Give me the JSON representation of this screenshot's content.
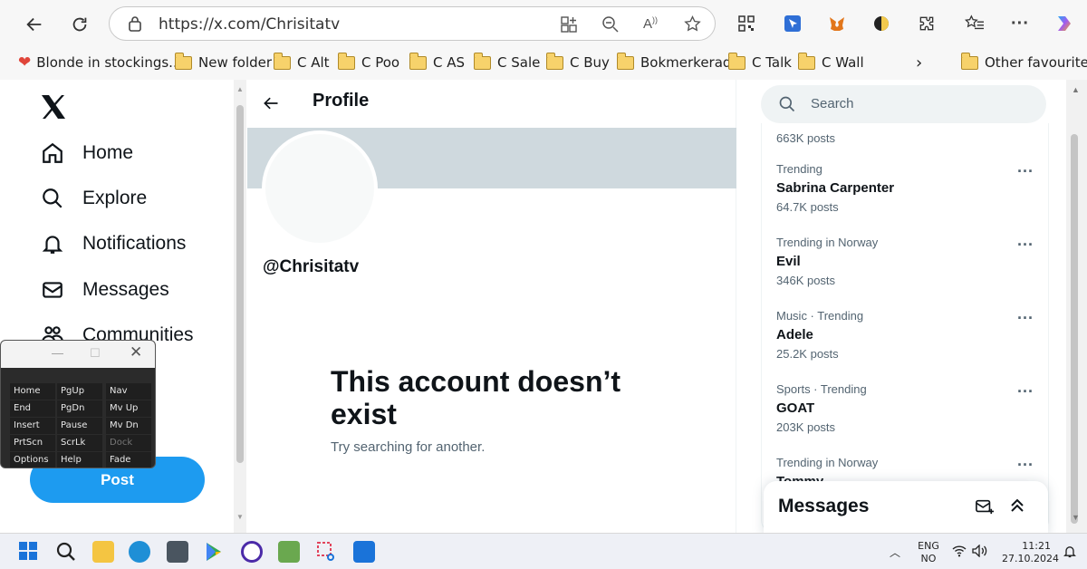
{
  "browser": {
    "url": "https://x.com/Chrisitatv",
    "bookmarks": [
      {
        "label": "Blonde in stockings..."
      },
      {
        "label": "New folder"
      },
      {
        "label": "C Alt"
      },
      {
        "label": "C Poo"
      },
      {
        "label": "C AS"
      },
      {
        "label": "C Sale"
      },
      {
        "label": "C Buy"
      },
      {
        "label": "Bokmerkerad"
      },
      {
        "label": "C Talk"
      },
      {
        "label": "C Wall"
      }
    ],
    "other_favourites": "Other favourites"
  },
  "sidebar": {
    "logo": "x-logo-icon",
    "items": [
      {
        "label": "Home",
        "icon": "home-icon"
      },
      {
        "label": "Explore",
        "icon": "search-icon"
      },
      {
        "label": "Notifications",
        "icon": "bell-icon"
      },
      {
        "label": "Messages",
        "icon": "envelope-icon"
      },
      {
        "label": "Communities",
        "icon": "people-icon"
      }
    ],
    "post_label": "Post"
  },
  "profile": {
    "title": "Profile",
    "handle": "@Chrisitatv",
    "empty_title": "This account doesn’t exist",
    "empty_subtitle": "Try searching for another."
  },
  "right": {
    "search_placeholder": "Search",
    "top_count": "663K posts",
    "trends": [
      {
        "context": "Trending",
        "name": "Sabrina Carpenter",
        "count": "64.7K posts"
      },
      {
        "context": "Trending in Norway",
        "name": "Evil",
        "count": "346K posts"
      },
      {
        "context": "Music · Trending",
        "name": "Adele",
        "count": "25.2K posts"
      },
      {
        "context": "Sports · Trending",
        "name": "GOAT",
        "count": "203K posts"
      },
      {
        "context": "Trending in Norway",
        "name": "Tommy",
        "count": ""
      }
    ],
    "messages_title": "Messages"
  },
  "osk": {
    "keys": [
      [
        "Home",
        "PgUp",
        "Nav"
      ],
      [
        "End",
        "PgDn",
        "Mv Up"
      ],
      [
        "Insert",
        "Pause",
        "Mv Dn"
      ],
      [
        "PrtScn",
        "ScrLk",
        "Dock"
      ],
      [
        "Options",
        "Help",
        "Fade"
      ]
    ]
  },
  "taskbar": {
    "lang_top": "ENG",
    "lang_bottom": "NO",
    "time": "11:21",
    "date": "27.10.2024"
  },
  "colors": {
    "accent": "#1d9bf0",
    "banner": "#cfd9de",
    "muted": "#536471"
  }
}
